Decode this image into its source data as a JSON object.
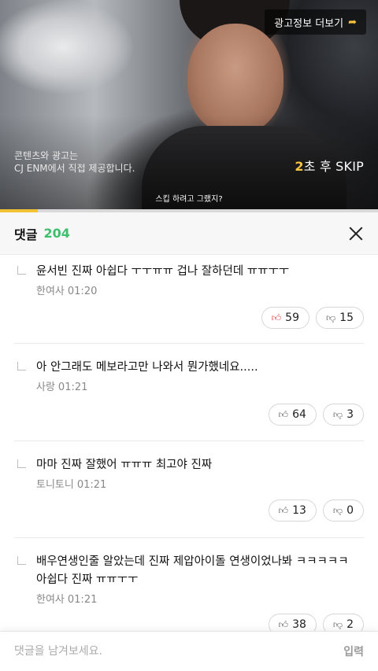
{
  "ad": {
    "info_button": "광고정보 더보기",
    "provider_line1": "콘텐츠와 광고는",
    "provider_line2": "CJ ENM에서 직접 제공합니다.",
    "skip_seconds": "2",
    "skip_suffix": "초 후 SKIP",
    "caption": "스킵 하려고 그랬지?",
    "progress_fraction": 0.1,
    "colors": {
      "accent": "#f1c232",
      "track": "#d9d9d9"
    }
  },
  "comments_header": {
    "title": "댓글",
    "count": "204",
    "count_color": "#3fbf6e"
  },
  "comments": [
    {
      "text": "윤서빈 진짜 아쉽다 ㅜㅜㅠㅠ 겁나 잘하던데 ㅠㅠㅜㅜ",
      "author": "한여사",
      "time": "01:20",
      "likes": "59",
      "dislikes": "15",
      "liked": true
    },
    {
      "text": "아 안그래도 메보라고만 나와서 뭔가했네요.....",
      "author": "사랑",
      "time": "01:21",
      "likes": "64",
      "dislikes": "3",
      "liked": false
    },
    {
      "text": "마마 진짜 잘했어 ㅠㅠㅠ 최고야 진짜",
      "author": "토니토니",
      "time": "01:21",
      "likes": "13",
      "dislikes": "0",
      "liked": false
    },
    {
      "text": "배우연생인줄 알았는데 진짜 제압아이돌 연생이었나봐 ㅋㅋㅋㅋㅋ 아쉽다 진짜 ㅠㅠㅜㅜ",
      "author": "한여사",
      "time": "01:21",
      "likes": "38",
      "dislikes": "2",
      "liked": false
    }
  ],
  "input": {
    "placeholder": "댓글을 남겨보세요.",
    "value": "",
    "submit_label": "입력"
  },
  "icons": {
    "like": "thumbs-up-icon",
    "dislike": "thumbs-down-icon",
    "reply": "reply-arrow-icon",
    "close": "close-icon",
    "share": "share-arrow-icon"
  }
}
